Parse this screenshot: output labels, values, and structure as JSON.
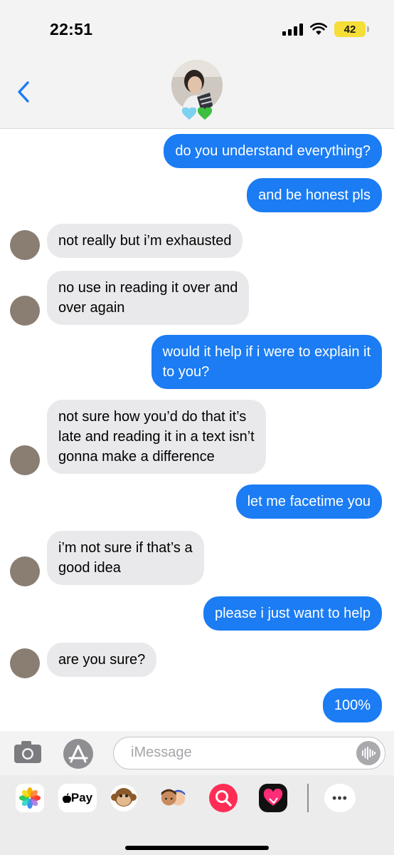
{
  "status_bar": {
    "time": "22:51",
    "battery": "42"
  },
  "header": {
    "hearts": "🩵💚"
  },
  "messages": [
    {
      "side": "sent",
      "text": "do you understand everything?"
    },
    {
      "side": "sent",
      "text": "and be honest pls"
    },
    {
      "side": "recv",
      "text": "not really but i’m exhausted"
    },
    {
      "side": "recv",
      "text": "no use in reading it over and\nover again"
    },
    {
      "side": "sent",
      "text": "would it help if i were to explain it\nto you?"
    },
    {
      "side": "recv",
      "text": "not sure how you’d do that it’s\nlate and reading it in a text isn’t\ngonna make a difference"
    },
    {
      "side": "sent",
      "text": "let me facetime you"
    },
    {
      "side": "recv",
      "text": "i’m not sure if that’s a\ngood idea"
    },
    {
      "side": "sent",
      "text": "please i just want to help"
    },
    {
      "side": "recv",
      "text": "are you sure?"
    },
    {
      "side": "sent",
      "text": "100%"
    }
  ],
  "compose": {
    "placeholder": "iMessage"
  },
  "apps": {
    "pay_label": "Pay",
    "more": "•••"
  },
  "colors": {
    "sent_bubble": "#1b7cf3",
    "received_bubble": "#e9e9eb",
    "accent": "#1b7cf3"
  }
}
